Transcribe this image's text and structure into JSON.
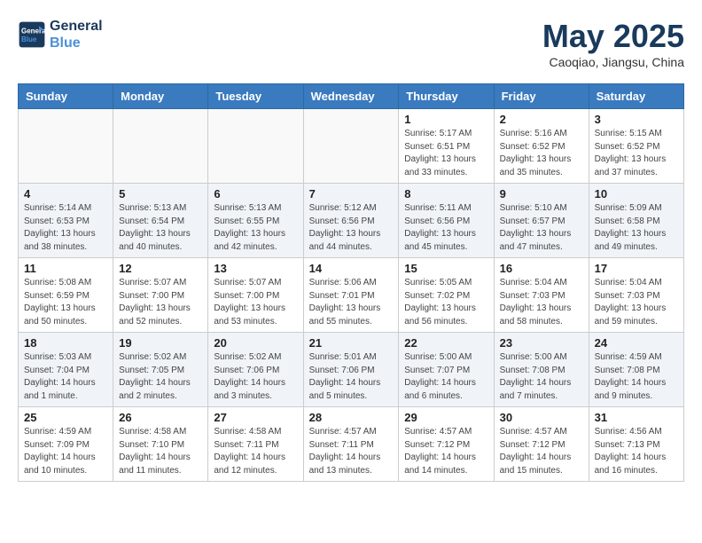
{
  "logo": {
    "line1": "General",
    "line2": "Blue"
  },
  "title": "May 2025",
  "location": "Caoqiao, Jiangsu, China",
  "weekdays": [
    "Sunday",
    "Monday",
    "Tuesday",
    "Wednesday",
    "Thursday",
    "Friday",
    "Saturday"
  ],
  "weeks": [
    [
      {
        "day": "",
        "info": ""
      },
      {
        "day": "",
        "info": ""
      },
      {
        "day": "",
        "info": ""
      },
      {
        "day": "",
        "info": ""
      },
      {
        "day": "1",
        "info": "Sunrise: 5:17 AM\nSunset: 6:51 PM\nDaylight: 13 hours\nand 33 minutes."
      },
      {
        "day": "2",
        "info": "Sunrise: 5:16 AM\nSunset: 6:52 PM\nDaylight: 13 hours\nand 35 minutes."
      },
      {
        "day": "3",
        "info": "Sunrise: 5:15 AM\nSunset: 6:52 PM\nDaylight: 13 hours\nand 37 minutes."
      }
    ],
    [
      {
        "day": "4",
        "info": "Sunrise: 5:14 AM\nSunset: 6:53 PM\nDaylight: 13 hours\nand 38 minutes."
      },
      {
        "day": "5",
        "info": "Sunrise: 5:13 AM\nSunset: 6:54 PM\nDaylight: 13 hours\nand 40 minutes."
      },
      {
        "day": "6",
        "info": "Sunrise: 5:13 AM\nSunset: 6:55 PM\nDaylight: 13 hours\nand 42 minutes."
      },
      {
        "day": "7",
        "info": "Sunrise: 5:12 AM\nSunset: 6:56 PM\nDaylight: 13 hours\nand 44 minutes."
      },
      {
        "day": "8",
        "info": "Sunrise: 5:11 AM\nSunset: 6:56 PM\nDaylight: 13 hours\nand 45 minutes."
      },
      {
        "day": "9",
        "info": "Sunrise: 5:10 AM\nSunset: 6:57 PM\nDaylight: 13 hours\nand 47 minutes."
      },
      {
        "day": "10",
        "info": "Sunrise: 5:09 AM\nSunset: 6:58 PM\nDaylight: 13 hours\nand 49 minutes."
      }
    ],
    [
      {
        "day": "11",
        "info": "Sunrise: 5:08 AM\nSunset: 6:59 PM\nDaylight: 13 hours\nand 50 minutes."
      },
      {
        "day": "12",
        "info": "Sunrise: 5:07 AM\nSunset: 7:00 PM\nDaylight: 13 hours\nand 52 minutes."
      },
      {
        "day": "13",
        "info": "Sunrise: 5:07 AM\nSunset: 7:00 PM\nDaylight: 13 hours\nand 53 minutes."
      },
      {
        "day": "14",
        "info": "Sunrise: 5:06 AM\nSunset: 7:01 PM\nDaylight: 13 hours\nand 55 minutes."
      },
      {
        "day": "15",
        "info": "Sunrise: 5:05 AM\nSunset: 7:02 PM\nDaylight: 13 hours\nand 56 minutes."
      },
      {
        "day": "16",
        "info": "Sunrise: 5:04 AM\nSunset: 7:03 PM\nDaylight: 13 hours\nand 58 minutes."
      },
      {
        "day": "17",
        "info": "Sunrise: 5:04 AM\nSunset: 7:03 PM\nDaylight: 13 hours\nand 59 minutes."
      }
    ],
    [
      {
        "day": "18",
        "info": "Sunrise: 5:03 AM\nSunset: 7:04 PM\nDaylight: 14 hours\nand 1 minute."
      },
      {
        "day": "19",
        "info": "Sunrise: 5:02 AM\nSunset: 7:05 PM\nDaylight: 14 hours\nand 2 minutes."
      },
      {
        "day": "20",
        "info": "Sunrise: 5:02 AM\nSunset: 7:06 PM\nDaylight: 14 hours\nand 3 minutes."
      },
      {
        "day": "21",
        "info": "Sunrise: 5:01 AM\nSunset: 7:06 PM\nDaylight: 14 hours\nand 5 minutes."
      },
      {
        "day": "22",
        "info": "Sunrise: 5:00 AM\nSunset: 7:07 PM\nDaylight: 14 hours\nand 6 minutes."
      },
      {
        "day": "23",
        "info": "Sunrise: 5:00 AM\nSunset: 7:08 PM\nDaylight: 14 hours\nand 7 minutes."
      },
      {
        "day": "24",
        "info": "Sunrise: 4:59 AM\nSunset: 7:08 PM\nDaylight: 14 hours\nand 9 minutes."
      }
    ],
    [
      {
        "day": "25",
        "info": "Sunrise: 4:59 AM\nSunset: 7:09 PM\nDaylight: 14 hours\nand 10 minutes."
      },
      {
        "day": "26",
        "info": "Sunrise: 4:58 AM\nSunset: 7:10 PM\nDaylight: 14 hours\nand 11 minutes."
      },
      {
        "day": "27",
        "info": "Sunrise: 4:58 AM\nSunset: 7:11 PM\nDaylight: 14 hours\nand 12 minutes."
      },
      {
        "day": "28",
        "info": "Sunrise: 4:57 AM\nSunset: 7:11 PM\nDaylight: 14 hours\nand 13 minutes."
      },
      {
        "day": "29",
        "info": "Sunrise: 4:57 AM\nSunset: 7:12 PM\nDaylight: 14 hours\nand 14 minutes."
      },
      {
        "day": "30",
        "info": "Sunrise: 4:57 AM\nSunset: 7:12 PM\nDaylight: 14 hours\nand 15 minutes."
      },
      {
        "day": "31",
        "info": "Sunrise: 4:56 AM\nSunset: 7:13 PM\nDaylight: 14 hours\nand 16 minutes."
      }
    ]
  ]
}
